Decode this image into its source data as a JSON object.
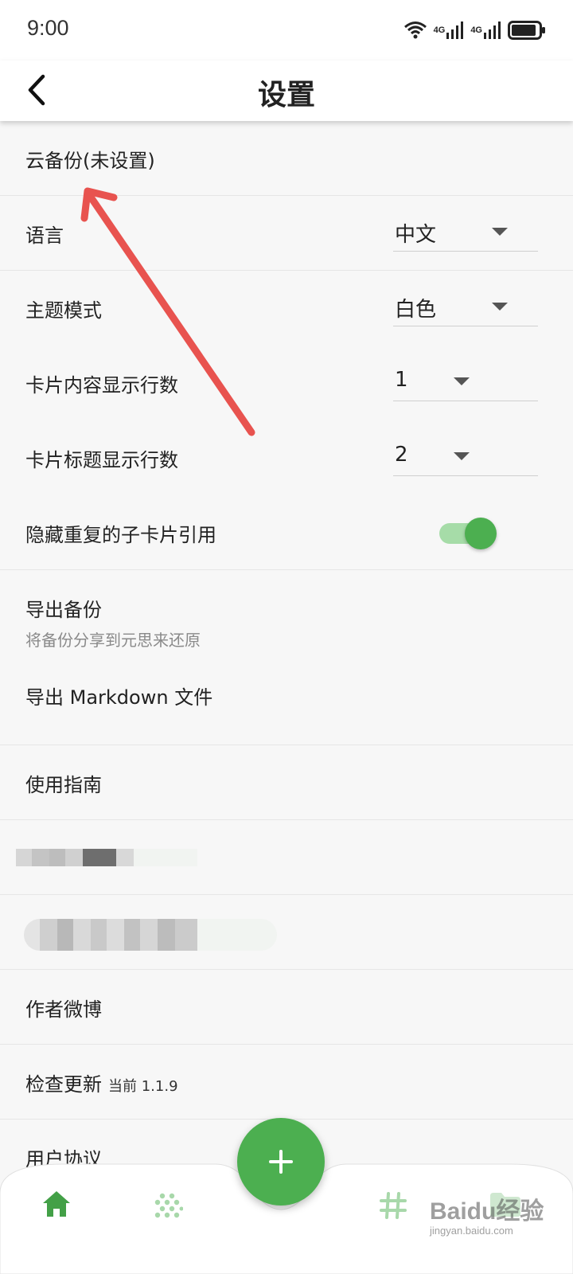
{
  "status_bar": {
    "time": "9:00",
    "net1": "4G",
    "net2": "4G"
  },
  "app_bar": {
    "title": "设置",
    "back_icon": "chevron-left-icon"
  },
  "settings": {
    "cloud_backup": "云备份(未设置)",
    "language": {
      "label": "语言",
      "value": "中文"
    },
    "theme": {
      "label": "主题模式",
      "value": "白色"
    },
    "card_content_lines": {
      "label": "卡片内容显示行数",
      "value": "1"
    },
    "card_title_lines": {
      "label": "卡片标题显示行数",
      "value": "2"
    },
    "hide_duplicate": {
      "label": "隐藏重复的子卡片引用",
      "enabled": true
    },
    "export_backup": {
      "label": "导出备份",
      "sub": "将备份分享到元思来还原"
    },
    "export_markdown": "导出 Markdown 文件",
    "guide": "使用指南",
    "author_weibo": "作者微博",
    "check_update": {
      "label": "检查更新",
      "note": "当前 1.1.9"
    },
    "user_agreement": "用户协议"
  },
  "bottom_nav": {
    "home_icon": "home-icon",
    "dots_icon": "dots-pattern-icon",
    "add_icon": "plus-icon",
    "tag_icon": "hashtag-icon",
    "folder_icon": "folder-icon"
  },
  "watermark": {
    "main": "Baidu经验",
    "sub": "jingyan.baidu.com"
  },
  "colors": {
    "accent": "#4caf50",
    "annotation_arrow": "#e8534f"
  }
}
